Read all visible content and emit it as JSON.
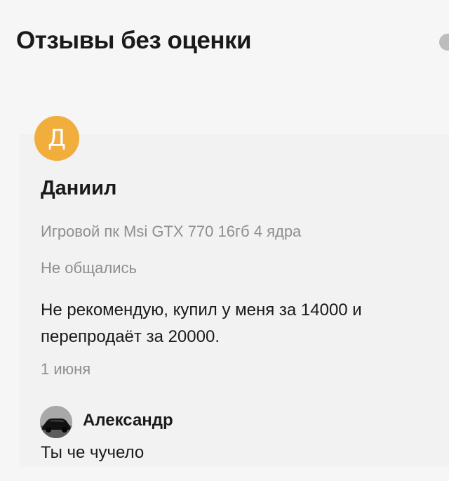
{
  "section": {
    "title": "Отзывы без оценки"
  },
  "review": {
    "avatar_letter": "Д",
    "avatar_color": "#f2ae3d",
    "author": "Даниил",
    "product": "Игровой пк Msi GTX 770 16гб 4 ядра",
    "deal_status": "Не общались",
    "text": "Не рекомендую, купил у меня за 14000 и перепродаёт за 20000.",
    "date": "1 июня"
  },
  "reply": {
    "avatar_icon": "car-photo-avatar",
    "author": "Александр",
    "text": "Ты че чучело"
  }
}
